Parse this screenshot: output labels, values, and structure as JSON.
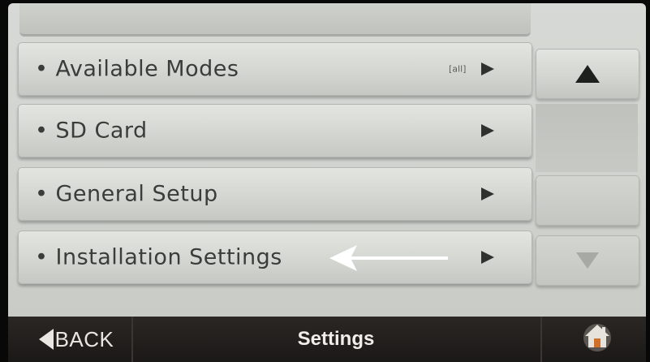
{
  "menu": {
    "items": [
      {
        "label": "• Available Modes",
        "badge": "[all]"
      },
      {
        "label": "• SD Card",
        "badge": ""
      },
      {
        "label": "• General Setup",
        "badge": ""
      },
      {
        "label": "• Installation Settings",
        "badge": ""
      }
    ]
  },
  "footer": {
    "back_label": "BACK",
    "title": "Settings"
  },
  "icons": {
    "scroll_up": "triangle-up",
    "scroll_down": "triangle-down",
    "home": "home",
    "back": "triangle-left",
    "item_chevron": "triangle-right"
  },
  "colors": {
    "screen_bg": "#d4d6d2",
    "footer_bg": "#211f1c",
    "footer_text": "#f0eee9",
    "menu_text": "#3b3d3a"
  }
}
